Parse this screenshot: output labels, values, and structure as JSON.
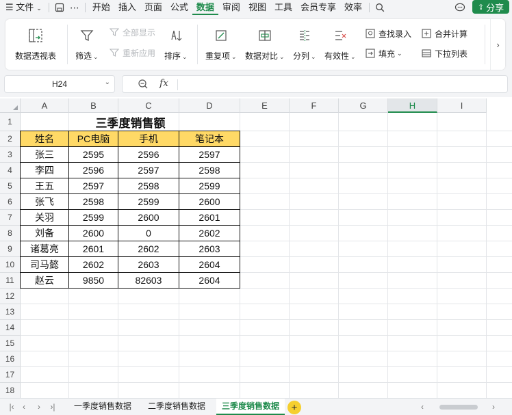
{
  "menubar": {
    "file_label": "文件",
    "items": [
      "开始",
      "插入",
      "页面",
      "公式",
      "数据",
      "审阅",
      "视图",
      "工具",
      "会员专享",
      "效率"
    ],
    "active_item": "数据",
    "share_label": "分享"
  },
  "ribbon": {
    "pivot": "数据透视表",
    "filter": "筛选",
    "show_all": "全部显示",
    "reapply": "重新应用",
    "sort": "排序",
    "duplicates": "重复项",
    "compare": "数据对比",
    "split": "分列",
    "validity": "有效性",
    "fill": "填充",
    "find_entry": "查找录入",
    "consolidate": "合并计算",
    "dropdown_list": "下拉列表"
  },
  "formula_bar": {
    "name_box": "H24",
    "fx_label": "fx",
    "formula_value": ""
  },
  "grid": {
    "columns": [
      "A",
      "B",
      "C",
      "D",
      "E",
      "F",
      "G",
      "H",
      "I"
    ],
    "selected_column": "H",
    "rows": [
      "1",
      "2",
      "3",
      "4",
      "5",
      "6",
      "7",
      "8",
      "9",
      "10",
      "11",
      "12",
      "13",
      "14",
      "15",
      "16",
      "17",
      "18"
    ],
    "title": "三季度销售额",
    "headers": [
      "姓名",
      "PC电脑",
      "手机",
      "笔记本"
    ],
    "data": [
      [
        "张三",
        "2595",
        "2596",
        "2597"
      ],
      [
        "李四",
        "2596",
        "2597",
        "2598"
      ],
      [
        "王五",
        "2597",
        "2598",
        "2599"
      ],
      [
        "张飞",
        "2598",
        "2599",
        "2600"
      ],
      [
        "关羽",
        "2599",
        "2600",
        "2601"
      ],
      [
        "刘备",
        "2600",
        "0",
        "2602"
      ],
      [
        "诸葛亮",
        "2601",
        "2602",
        "2603"
      ],
      [
        "司马懿",
        "2602",
        "2603",
        "2604"
      ],
      [
        "赵云",
        "9850",
        "82603",
        "2604"
      ]
    ],
    "header_fill": "#ffd966"
  },
  "sheets": {
    "tabs": [
      "一季度销售数据",
      "二季度销售数据",
      "三季度销售数据"
    ],
    "active": "三季度销售数据",
    "add_label": "+"
  },
  "colors": {
    "accent": "#1f8b4c",
    "header_fill": "#ffd966"
  }
}
